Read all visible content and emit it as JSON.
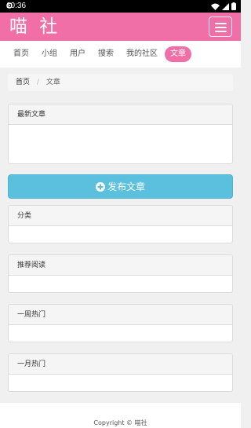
{
  "status_bar": {
    "time": "10:36",
    "icons": [
      "gear-icon",
      "wifi-icon",
      "signal-icon",
      "battery-icon"
    ]
  },
  "header": {
    "brand": "喵 社",
    "menu_icon": "hamburger-menu-icon"
  },
  "nav": {
    "items": [
      {
        "label": "首页"
      },
      {
        "label": "小组"
      },
      {
        "label": "用户"
      },
      {
        "label": "搜索"
      },
      {
        "label": "我的社区"
      },
      {
        "label": "文章"
      }
    ],
    "active_index": 5
  },
  "breadcrumb": {
    "items": [
      "首页",
      "文章"
    ],
    "separator": "/"
  },
  "panels": {
    "latest": {
      "title": "最新文章"
    },
    "category": {
      "title": "分类"
    },
    "recommended": {
      "title": "推荐阅读"
    },
    "weekly_hot": {
      "title": "一周热门"
    },
    "monthly_hot": {
      "title": "一月热门"
    }
  },
  "publish_button": {
    "label": "发布文章",
    "icon": "plus-circle-icon"
  },
  "footer": {
    "text": "Copyright © 喵社"
  },
  "colors": {
    "brand_pink": "#f06fa6",
    "info_blue": "#5bc0de",
    "panel_heading": "#f5f5f5",
    "background": "#f0f0f0"
  }
}
